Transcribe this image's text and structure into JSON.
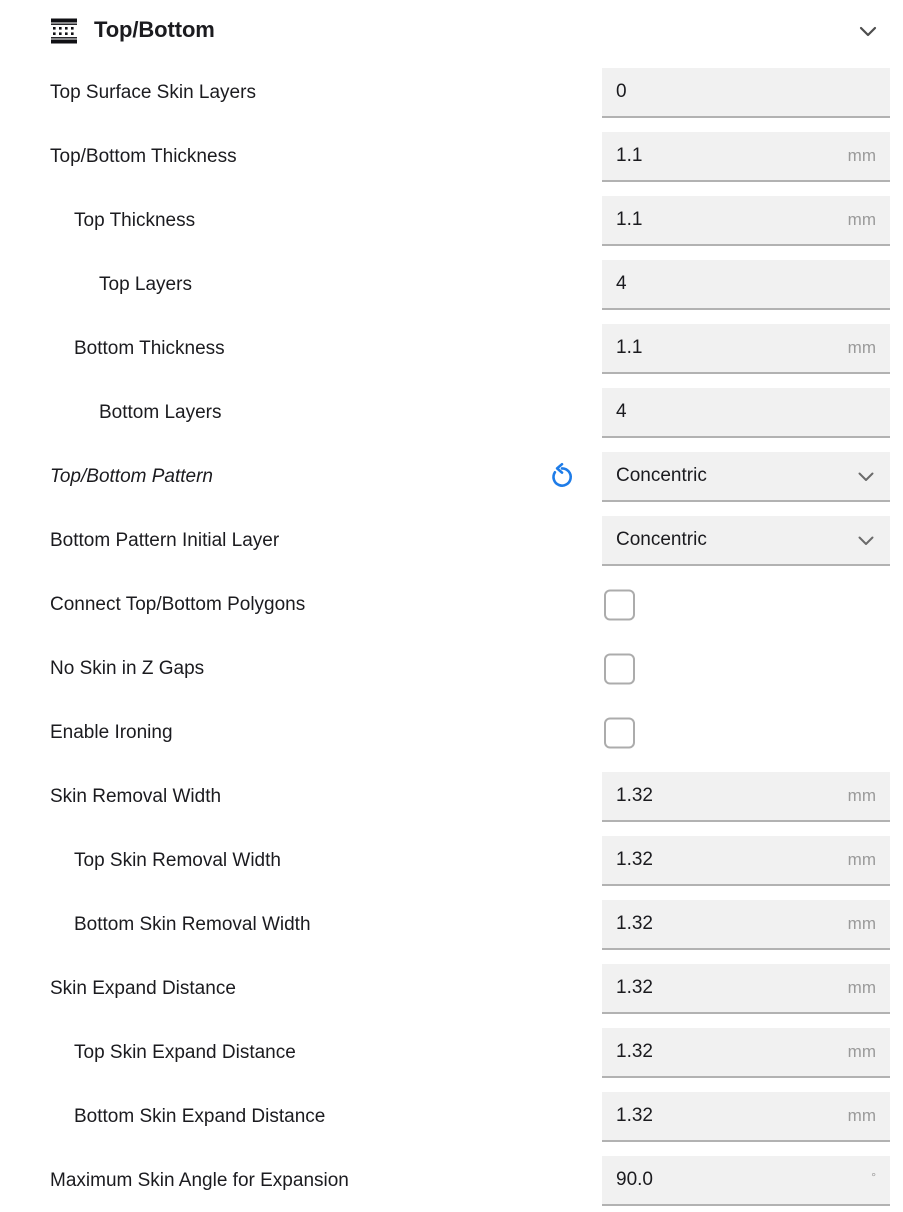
{
  "header": {
    "title": "Top/Bottom",
    "icon": "top-bottom-layers-icon",
    "collapse_icon": "chevron-down-icon"
  },
  "colors": {
    "accent_revert": "#1e7ce8",
    "field_background": "#f1f1f1",
    "field_underline": "#b2b2b2",
    "text": "#1b1b1f",
    "unit_text": "#9a9a9a",
    "checkbox_border": "#acacac"
  },
  "settings": [
    {
      "label": "Top Surface Skin Layers",
      "indent": 0,
      "control": "text",
      "value": "0",
      "unit": "",
      "modified": false,
      "revertable": false
    },
    {
      "label": "Top/Bottom Thickness",
      "indent": 0,
      "control": "text",
      "value": "1.1",
      "unit": "mm",
      "modified": false,
      "revertable": false
    },
    {
      "label": "Top Thickness",
      "indent": 1,
      "control": "text",
      "value": "1.1",
      "unit": "mm",
      "modified": false,
      "revertable": false
    },
    {
      "label": "Top Layers",
      "indent": 2,
      "control": "text",
      "value": "4",
      "unit": "",
      "modified": false,
      "revertable": false
    },
    {
      "label": "Bottom Thickness",
      "indent": 1,
      "control": "text",
      "value": "1.1",
      "unit": "mm",
      "modified": false,
      "revertable": false
    },
    {
      "label": "Bottom Layers",
      "indent": 2,
      "control": "text",
      "value": "4",
      "unit": "",
      "modified": false,
      "revertable": false
    },
    {
      "label": "Top/Bottom Pattern",
      "indent": 0,
      "control": "dropdown",
      "value": "Concentric",
      "unit": "",
      "modified": true,
      "revertable": true
    },
    {
      "label": "Bottom Pattern Initial Layer",
      "indent": 0,
      "control": "dropdown",
      "value": "Concentric",
      "unit": "",
      "modified": false,
      "revertable": false
    },
    {
      "label": "Connect Top/Bottom Polygons",
      "indent": 0,
      "control": "checkbox",
      "value": "",
      "unit": "",
      "checked": false,
      "modified": false,
      "revertable": false
    },
    {
      "label": "No Skin in Z Gaps",
      "indent": 0,
      "control": "checkbox",
      "value": "",
      "unit": "",
      "checked": false,
      "modified": false,
      "revertable": false
    },
    {
      "label": "Enable Ironing",
      "indent": 0,
      "control": "checkbox",
      "value": "",
      "unit": "",
      "checked": false,
      "modified": false,
      "revertable": false
    },
    {
      "label": "Skin Removal Width",
      "indent": 0,
      "control": "text",
      "value": "1.32",
      "unit": "mm",
      "modified": false,
      "revertable": false
    },
    {
      "label": "Top Skin Removal Width",
      "indent": 1,
      "control": "text",
      "value": "1.32",
      "unit": "mm",
      "modified": false,
      "revertable": false
    },
    {
      "label": "Bottom Skin Removal Width",
      "indent": 1,
      "control": "text",
      "value": "1.32",
      "unit": "mm",
      "modified": false,
      "revertable": false
    },
    {
      "label": "Skin Expand Distance",
      "indent": 0,
      "control": "text",
      "value": "1.32",
      "unit": "mm",
      "modified": false,
      "revertable": false
    },
    {
      "label": "Top Skin Expand Distance",
      "indent": 1,
      "control": "text",
      "value": "1.32",
      "unit": "mm",
      "modified": false,
      "revertable": false
    },
    {
      "label": "Bottom Skin Expand Distance",
      "indent": 1,
      "control": "text",
      "value": "1.32",
      "unit": "mm",
      "modified": false,
      "revertable": false
    },
    {
      "label": "Maximum Skin Angle for Expansion",
      "indent": 0,
      "control": "text",
      "value": "90.0",
      "unit": "°",
      "modified": false,
      "revertable": false
    }
  ]
}
